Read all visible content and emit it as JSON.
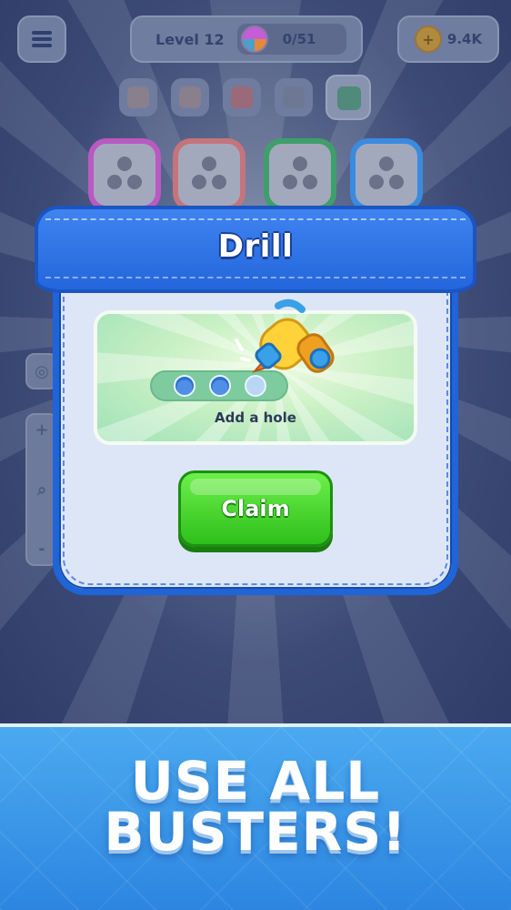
{
  "hud": {
    "level_label": "Level 12",
    "progress": "0/51",
    "coins": "9.4K",
    "menu_icon": "hamburger-menu-icon",
    "progress_icon": "yarn-ball-icon",
    "coin_icon": "coin-plus-icon"
  },
  "theme_icons": [
    "flower-icon",
    "box-icon",
    "bag-icon",
    "husky-dog-icon",
    "shop-icon"
  ],
  "spools": [
    {
      "color": "#b85ac2"
    },
    {
      "color": "#c5747c"
    },
    {
      "color": "#3f9f6a"
    },
    {
      "color": "#3a8be0"
    }
  ],
  "side_tools": {
    "target_icon": "target-icon",
    "plus": "+",
    "zoom_icon": "magnifier-icon",
    "minus": "-"
  },
  "dialog": {
    "title": "Drill",
    "caption": "Add a hole",
    "claim_label": "Claim",
    "booster_icon": "drill-icon",
    "holes_filled": 3
  },
  "banner": {
    "line1": "USE ALL",
    "line2": "BUSTERS!"
  },
  "colors": {
    "dialog_blue": "#2466dc",
    "claim_green": "#2fbf1c",
    "banner_blue": "#3a97e8"
  }
}
